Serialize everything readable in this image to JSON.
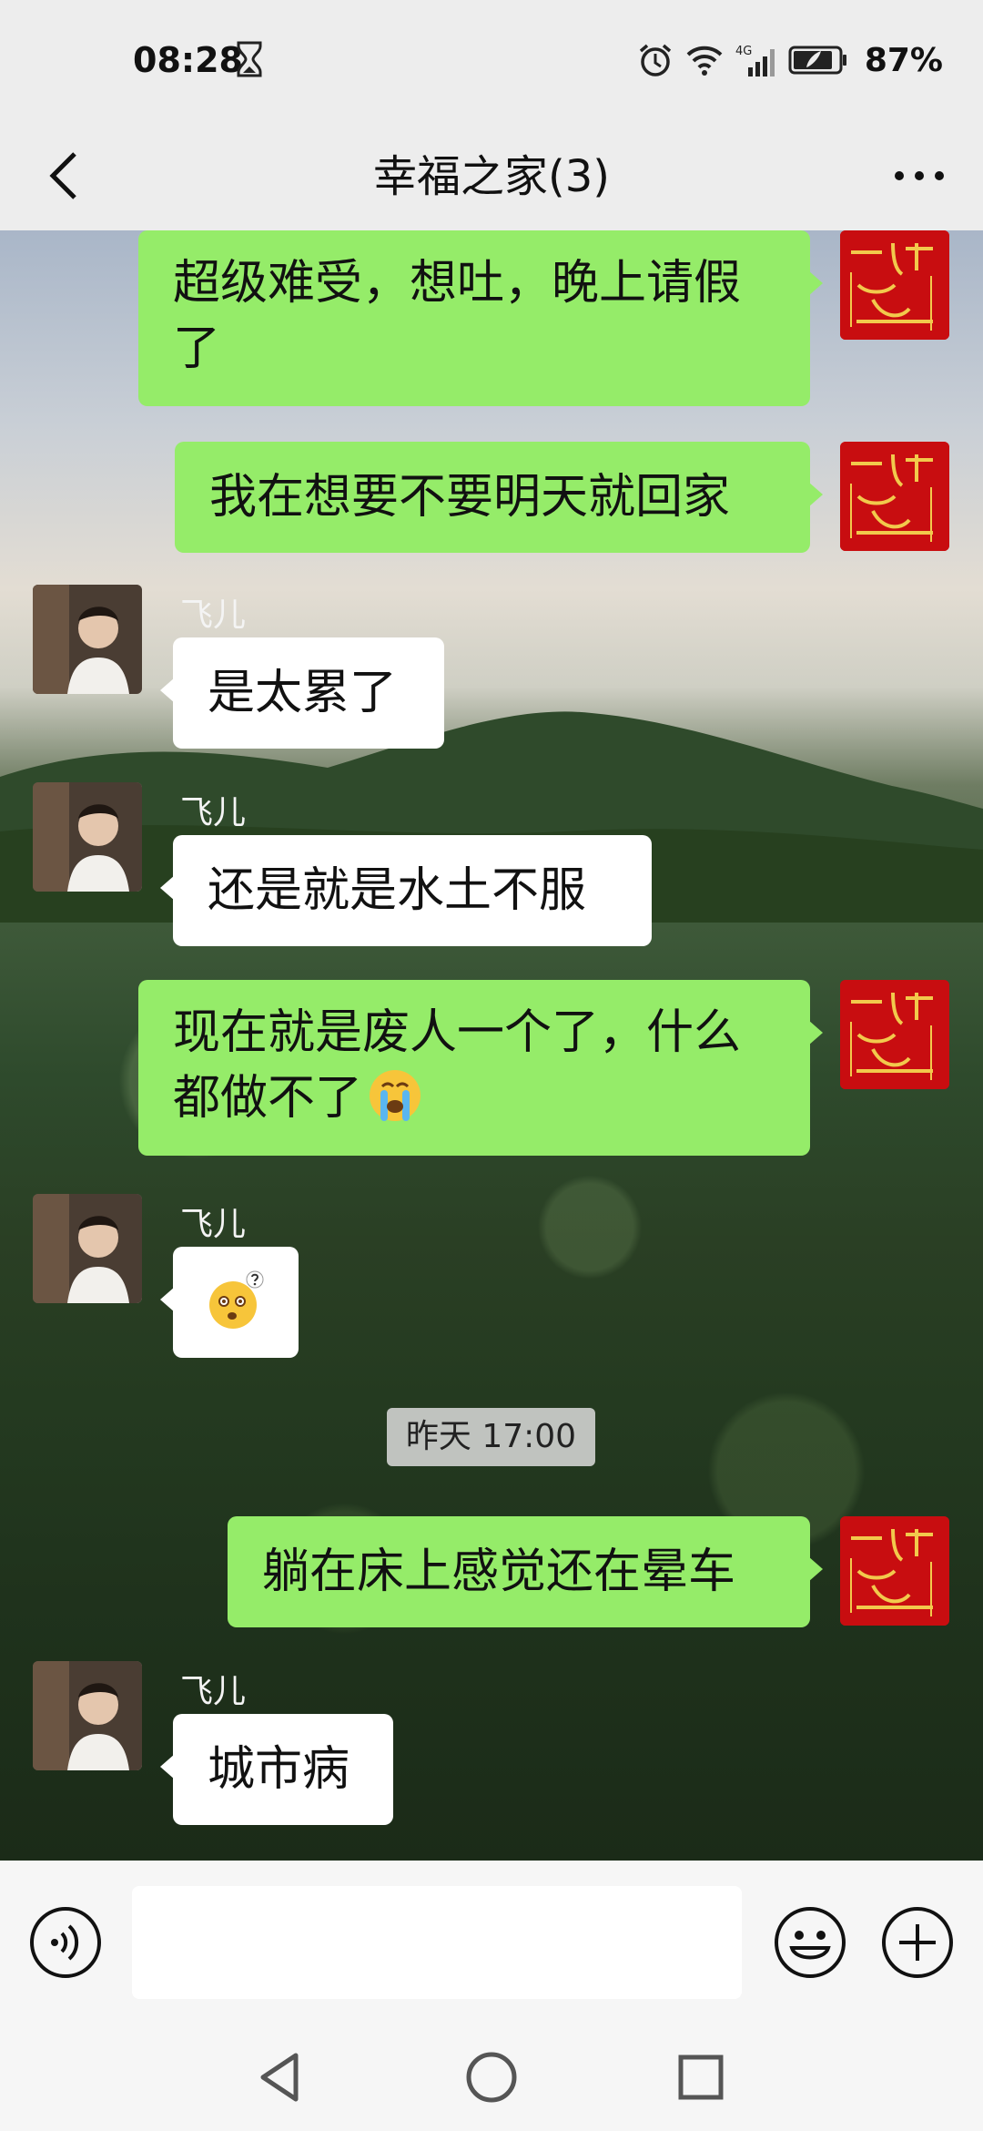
{
  "status": {
    "time": "08:28",
    "battery_percent": "87%",
    "network": "4G",
    "icons": [
      "hourglass-icon",
      "alarm-icon",
      "wifi-icon",
      "signal-icon",
      "battery-icon"
    ]
  },
  "header": {
    "title": "幸福之家(3)",
    "back_icon": "back-arrow-icon",
    "more_icon": "more-dots-icon"
  },
  "messages": [
    {
      "sender": "self",
      "text": "超级难受，想吐，晚上请假了"
    },
    {
      "sender": "self",
      "text": "我在想要不要明天就回家"
    },
    {
      "sender": "other",
      "name": "飞儿",
      "text": "是太累了"
    },
    {
      "sender": "other",
      "name": "飞儿",
      "text": "还是就是水土不服"
    },
    {
      "sender": "self",
      "text": "现在就是废人一个了，什么都做不了",
      "emoji": "crying-face-icon"
    },
    {
      "sender": "other",
      "name": "飞儿",
      "text": "",
      "emoji": "confused-face-icon"
    },
    {
      "sender": "self",
      "text": "躺在床上感觉还在晕车"
    },
    {
      "sender": "other",
      "name": "飞儿",
      "text": "城市病"
    }
  ],
  "timestamp": "昨天 17:00",
  "input": {
    "value": "",
    "placeholder": ""
  },
  "colors": {
    "self_bubble": "#95ec69",
    "other_bubble": "#ffffff",
    "self_avatar": "#c80d10"
  }
}
